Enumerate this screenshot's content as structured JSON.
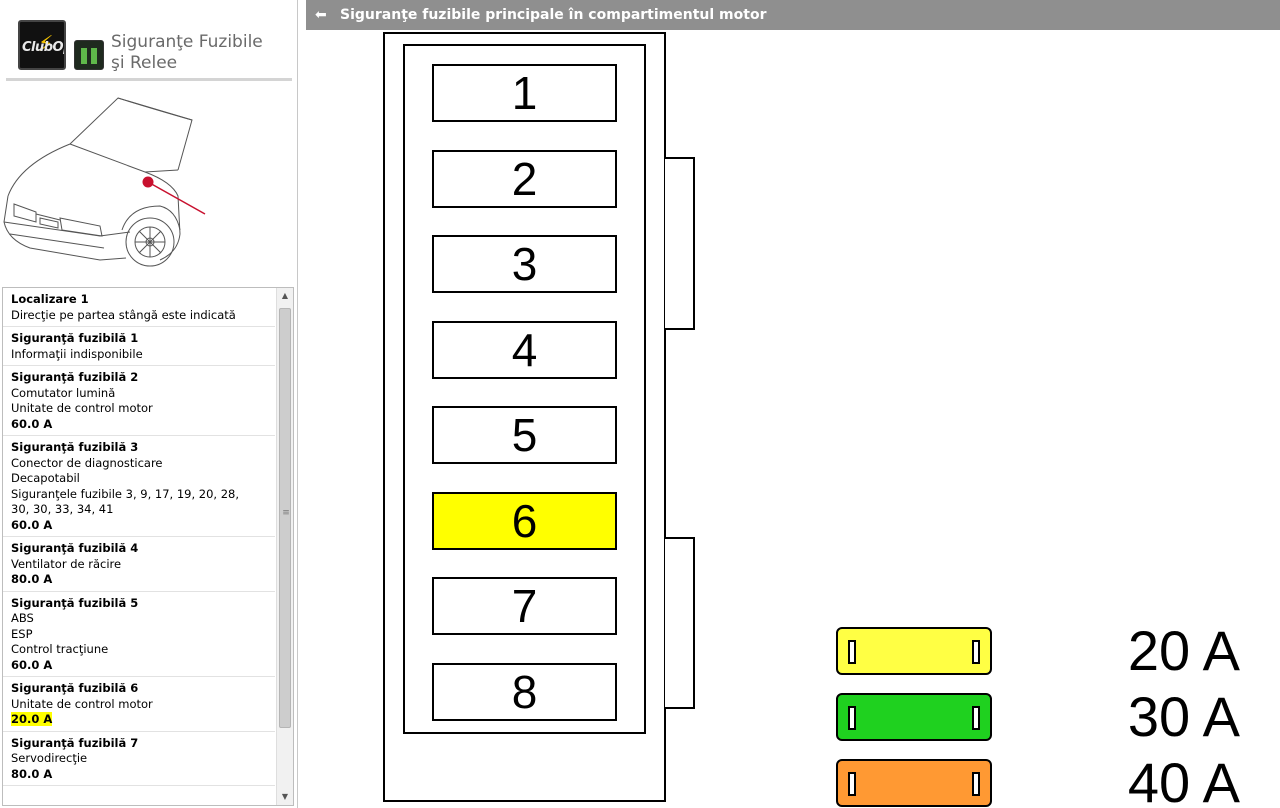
{
  "app": {
    "logo_wordmark": "ClubOpel.co",
    "title_line1": "Siguranţe Fuzibile",
    "title_line2": "şi Relee"
  },
  "title_bar": {
    "title": "Siguranţe fuzibile principale în compartimentul motor"
  },
  "list": [
    {
      "title": "Localizare 1",
      "lines": [
        "Direcţie pe partea stângă este indicată"
      ],
      "amp": "",
      "highlight": false
    },
    {
      "title": "Siguranţă fuzibilă 1",
      "lines": [
        "Informaţii indisponibile"
      ],
      "amp": "",
      "highlight": false
    },
    {
      "title": "Siguranţă fuzibilă 2",
      "lines": [
        "Comutator lumină",
        "Unitate de control motor"
      ],
      "amp": "60.0 A",
      "highlight": false
    },
    {
      "title": "Siguranţă fuzibilă 3",
      "lines": [
        "Conector de diagnosticare",
        "Decapotabil",
        "Siguranţele fuzibile 3, 9, 17, 19, 20, 28,",
        "30, 30, 33, 34, 41"
      ],
      "amp": "60.0 A",
      "highlight": false
    },
    {
      "title": "Siguranţă fuzibilă 4",
      "lines": [
        "Ventilator de răcire"
      ],
      "amp": "80.0 A",
      "highlight": false
    },
    {
      "title": "Siguranţă fuzibilă 5",
      "lines": [
        "ABS",
        "ESP",
        "Control tracţiune"
      ],
      "amp": "60.0 A",
      "highlight": false
    },
    {
      "title": "Siguranţă fuzibilă 6",
      "lines": [
        "Unitate de control motor"
      ],
      "amp": "20.0 A",
      "highlight": true
    },
    {
      "title": "Siguranţă fuzibilă 7",
      "lines": [
        "Servodirecţie"
      ],
      "amp": "80.0 A",
      "highlight": false
    }
  ],
  "fuses": [
    {
      "label": "1",
      "highlighted": false
    },
    {
      "label": "2",
      "highlighted": false
    },
    {
      "label": "3",
      "highlighted": false
    },
    {
      "label": "4",
      "highlighted": false
    },
    {
      "label": "5",
      "highlighted": false
    },
    {
      "label": "6",
      "highlighted": true
    },
    {
      "label": "7",
      "highlighted": false
    },
    {
      "label": "8",
      "highlighted": false
    }
  ],
  "legend": [
    {
      "label": "20 A",
      "color": "#ffff44"
    },
    {
      "label": "30 A",
      "color": "#1fd11f"
    },
    {
      "label": "40 A",
      "color": "#ff9933"
    }
  ],
  "colors": {
    "highlight": "#ffff00",
    "title_bar": "#8f8f8f",
    "location_marker": "#c8102e"
  },
  "icons": {
    "back": "arrow-left-icon",
    "logo": "clubopel-logo-icon",
    "relay": "relay-icon",
    "scroll_up": "triangle-up-icon",
    "scroll_down": "triangle-down-icon"
  }
}
